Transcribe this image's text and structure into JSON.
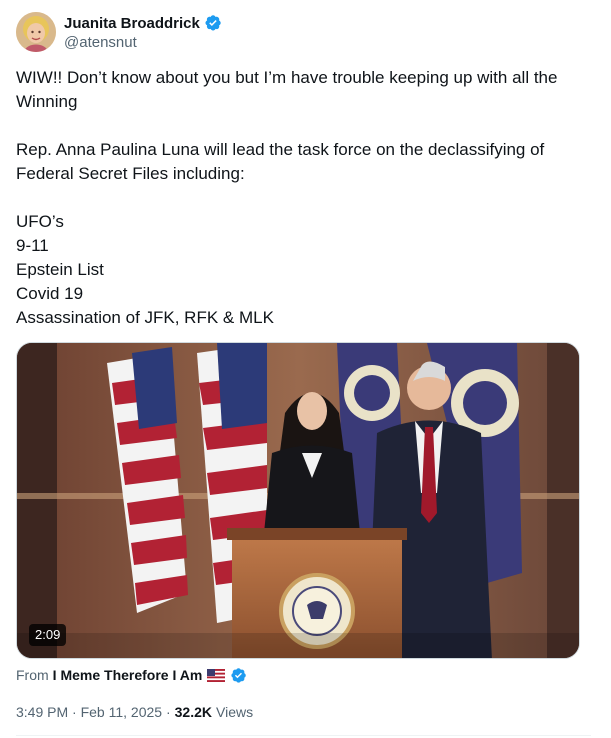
{
  "author": {
    "display_name": "Juanita Broaddrick",
    "handle": "@atensnut",
    "verified": true
  },
  "tweet": {
    "lines": [
      "WIW!!  Don’t know about you but I’m have trouble keeping up with all the Winning",
      "",
      "Rep. Anna Paulina Luna will lead the task force on the declassifying of Federal Secret Files including:",
      "",
      "UFO’s",
      "9-11",
      "Epstein List",
      "Covid 19",
      "Assassination of JFK, RFK & MLK"
    ]
  },
  "media": {
    "duration": "2:09",
    "seal_text": "U.S. HOUSE OF REPRESENTATIVES"
  },
  "source": {
    "prefix": "From",
    "name": "I Meme Therefore I Am",
    "flag_icon": "us-flag-icon",
    "verified": true
  },
  "meta": {
    "time": "3:49 PM",
    "date": "Feb 11, 2025",
    "views_count": "32.2K",
    "views_label": "Views"
  },
  "colors": {
    "verified_blue": "#1d9bf0",
    "text_primary": "#0f1419",
    "text_secondary": "#536471"
  }
}
